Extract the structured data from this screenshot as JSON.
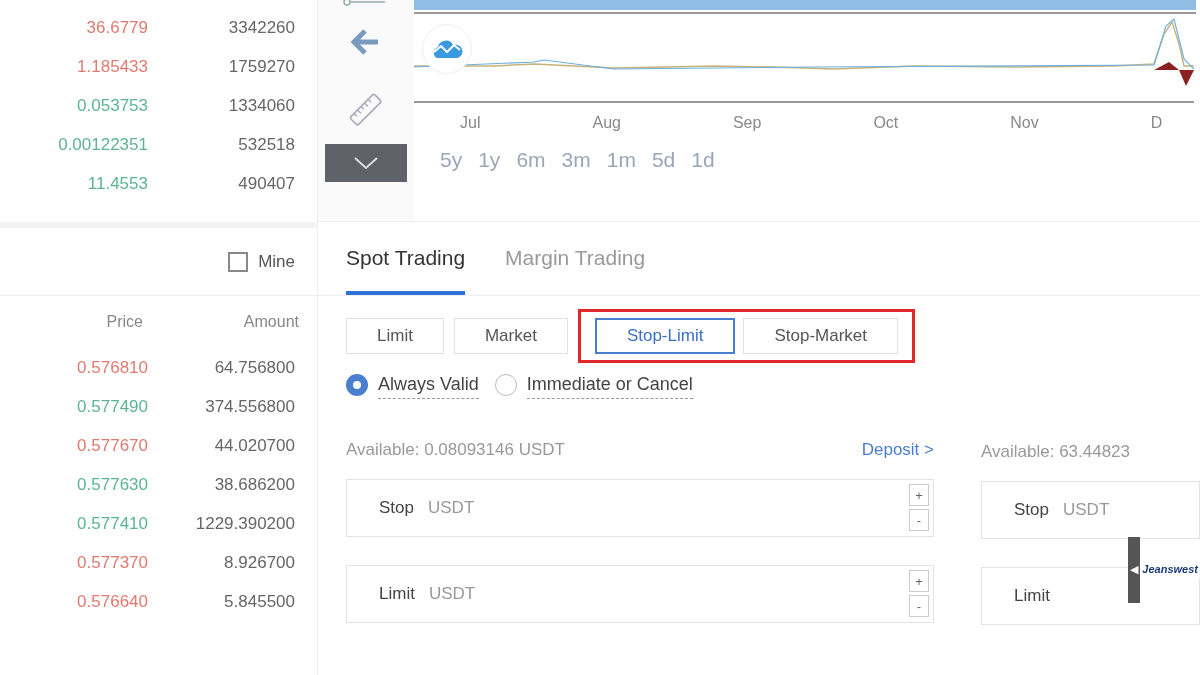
{
  "recent_trades": [
    {
      "price": "36.6779",
      "amount": "3342260",
      "color": "#e07a70"
    },
    {
      "price": "1.185433",
      "amount": "1759270",
      "color": "#e07a70"
    },
    {
      "price": "0.053753",
      "amount": "1334060",
      "color": "#5cb592"
    },
    {
      "price": "0.00122351",
      "amount": "532518",
      "color": "#5cb592"
    },
    {
      "price": "11.4553",
      "amount": "490407",
      "color": "#5cb592"
    }
  ],
  "mine_filter": {
    "label": "Mine",
    "checked": false
  },
  "order_book": {
    "columns": [
      "Price",
      "Amount"
    ],
    "rows": [
      {
        "price": "0.576810",
        "amount": "64.756800",
        "color": "#e07a70"
      },
      {
        "price": "0.577490",
        "amount": "374.556800",
        "color": "#5cb592"
      },
      {
        "price": "0.577670",
        "amount": "44.020700",
        "color": "#e07a70"
      },
      {
        "price": "0.577630",
        "amount": "38.686200",
        "color": "#5cb592"
      },
      {
        "price": "0.577410",
        "amount": "1229.390200",
        "color": "#5cb592"
      },
      {
        "price": "0.577370",
        "amount": "8.926700",
        "color": "#e07a70"
      },
      {
        "price": "0.576640",
        "amount": "5.845500",
        "color": "#e07a70"
      }
    ]
  },
  "chart": {
    "months": [
      "Jul",
      "Aug",
      "Sep",
      "Oct",
      "Nov",
      "D"
    ],
    "ranges": [
      "5y",
      "1y",
      "6m",
      "3m",
      "1m",
      "5d",
      "1d"
    ]
  },
  "trading_tabs": [
    {
      "label": "Spot Trading",
      "selected": true
    },
    {
      "label": "Margin Trading",
      "selected": false
    }
  ],
  "order_types": [
    {
      "label": "Limit",
      "selected": false,
      "highlighted": false
    },
    {
      "label": "Market",
      "selected": false,
      "highlighted": false
    },
    {
      "label": "Stop-Limit",
      "selected": true,
      "highlighted": true
    },
    {
      "label": "Stop-Market",
      "selected": false,
      "highlighted": true
    }
  ],
  "validity": [
    {
      "label": "Always Valid",
      "selected": true
    },
    {
      "label": "Immediate or Cancel",
      "selected": false
    }
  ],
  "buy_form": {
    "available": "Available: 0.08093146 USDT",
    "deposit": "Deposit >",
    "fields": [
      {
        "label": "Stop",
        "unit": "USDT",
        "plus": "+",
        "minus": "-"
      },
      {
        "label": "Limit",
        "unit": "USDT",
        "plus": "+",
        "minus": "-"
      }
    ]
  },
  "sell_form": {
    "available": "Available: 63.44823",
    "fields": [
      {
        "label": "Stop",
        "unit": "USDT"
      },
      {
        "label": "Limit"
      }
    ]
  },
  "ad_tab": {
    "arrow": "◀",
    "text": "Jeanswest"
  }
}
